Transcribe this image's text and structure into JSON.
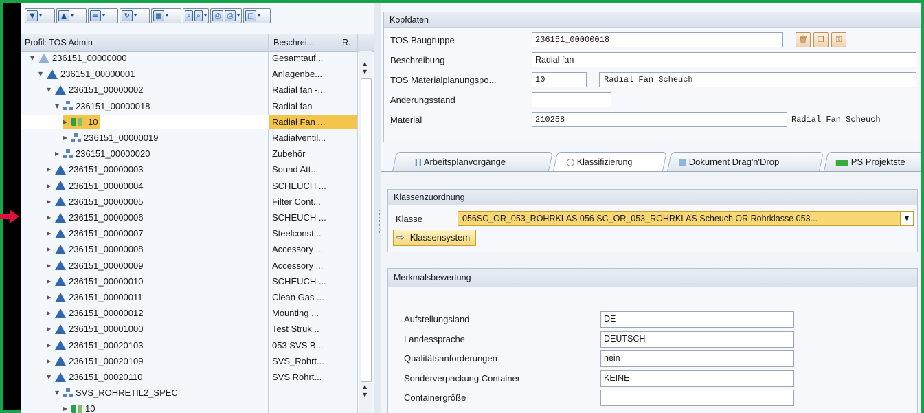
{
  "toolbar": {
    "buttons": [
      {
        "icon": "expand-icon",
        "glyph": "▼"
      },
      {
        "icon": "collapse-icon",
        "glyph": "▲"
      },
      {
        "icon": "list-icon",
        "glyph": "≡"
      },
      {
        "icon": "refresh-icon",
        "glyph": "↻"
      },
      {
        "icon": "layout-icon",
        "glyph": "▦"
      },
      {
        "icon": "find-icon",
        "glyph": "⌕"
      },
      {
        "icon": "print-icon",
        "glyph": "⎙"
      },
      {
        "icon": "window-icon",
        "glyph": "□"
      }
    ]
  },
  "tree_header": {
    "profile": "Profil: TOS Admin",
    "description": "Beschrei...",
    "r": "R."
  },
  "tree": [
    {
      "id": "236151_00000000",
      "desc": "Gesamtauf...",
      "level": 0,
      "expanded": true,
      "icon": "warn-partial"
    },
    {
      "id": "236151_00000001",
      "desc": "Anlagenbe...",
      "level": 1,
      "expanded": true,
      "icon": "warn"
    },
    {
      "id": "236151_00000002",
      "desc": "Radial fan -...",
      "level": 2,
      "expanded": true,
      "icon": "warn"
    },
    {
      "id": "236151_00000018",
      "desc": "Radial fan",
      "level": 3,
      "expanded": true,
      "icon": "org"
    },
    {
      "id": "10",
      "desc": "Radial Fan ...",
      "level": 4,
      "expanded": false,
      "icon": "link",
      "selected": true
    },
    {
      "id": "236151_00000019",
      "desc": "Radialventil...",
      "level": 4,
      "expanded": false,
      "icon": "org"
    },
    {
      "id": "236151_00000020",
      "desc": "Zubehör",
      "level": 3,
      "expanded": false,
      "icon": "org"
    },
    {
      "id": "236151_00000003",
      "desc": "Sound Att...",
      "level": 2,
      "expanded": false,
      "icon": "warn"
    },
    {
      "id": "236151_00000004",
      "desc": "SCHEUCH ...",
      "level": 2,
      "expanded": false,
      "icon": "warn"
    },
    {
      "id": "236151_00000005",
      "desc": "Filter Cont...",
      "level": 2,
      "expanded": false,
      "icon": "warn"
    },
    {
      "id": "236151_00000006",
      "desc": "SCHEUCH ...",
      "level": 2,
      "expanded": false,
      "icon": "warn"
    },
    {
      "id": "236151_00000007",
      "desc": "Steelconst...",
      "level": 2,
      "expanded": false,
      "icon": "warn"
    },
    {
      "id": "236151_00000008",
      "desc": "Accessory ...",
      "level": 2,
      "expanded": false,
      "icon": "warn"
    },
    {
      "id": "236151_00000009",
      "desc": "Accessory ...",
      "level": 2,
      "expanded": false,
      "icon": "warn"
    },
    {
      "id": "236151_00000010",
      "desc": "SCHEUCH ...",
      "level": 2,
      "expanded": false,
      "icon": "warn"
    },
    {
      "id": "236151_00000011",
      "desc": "Clean Gas ...",
      "level": 2,
      "expanded": false,
      "icon": "warn"
    },
    {
      "id": "236151_00000012",
      "desc": "Mounting ...",
      "level": 2,
      "expanded": false,
      "icon": "warn"
    },
    {
      "id": "236151_00001000",
      "desc": "Test Struk...",
      "level": 2,
      "expanded": false,
      "icon": "warn"
    },
    {
      "id": "236151_00020103",
      "desc": "053 SVS B...",
      "level": 2,
      "expanded": false,
      "icon": "warn"
    },
    {
      "id": "236151_00020109",
      "desc": "SVS_Rohrt...",
      "level": 2,
      "expanded": false,
      "icon": "warn"
    },
    {
      "id": "236151_00020110",
      "desc": "SVS Rohrt...",
      "level": 2,
      "expanded": true,
      "icon": "warn"
    },
    {
      "id": "SVS_ROHRETIL2_SPEC",
      "desc": "",
      "level": 3,
      "expanded": true,
      "icon": "org"
    },
    {
      "id": "10",
      "desc": "",
      "level": 4,
      "expanded": false,
      "icon": "link"
    }
  ],
  "kopfdaten": {
    "title": "Kopfdaten",
    "baugruppe_label": "TOS Baugruppe",
    "baugruppe_value": "236151_00000018",
    "beschreibung_label": "Beschreibung",
    "beschreibung_value": "Radial fan",
    "materialplanung_label": "TOS Materialplanungspo...",
    "materialplanung_value": "10",
    "materialplanung_text": "Radial Fan Scheuch",
    "aenderung_label": "Änderungsstand",
    "aenderung_value": "",
    "material_label": "Material",
    "material_value": "210258",
    "material_text": "Radial Fan Scheuch"
  },
  "tabs": [
    {
      "label": "Arbeitsplanvorgänge",
      "icon": "operations-icon"
    },
    {
      "label": "Klassifizierung",
      "icon": "classification-icon",
      "active": true
    },
    {
      "label": "Dokument Drag'n'Drop",
      "icon": "document-icon"
    },
    {
      "label": "PS Projektste",
      "icon": "project-icon"
    }
  ],
  "klassenzuordnung": {
    "title": "Klassenzuordnung",
    "klasse_label": "Klasse",
    "klasse_value": "056SC_OR_053_ROHRKLAS 056 SC_OR_053_ROHRKLAS Scheuch OR Rohrklasse 053...",
    "klassensystem_button": "Klassensystem"
  },
  "merkmalsbewertung": {
    "title": "Merkmalsbewertung",
    "rows": [
      {
        "label": "Aufstellungsland",
        "value": "DE"
      },
      {
        "label": "Landessprache",
        "value": "DEUTSCH"
      },
      {
        "label": "Qualitätsanforderungen",
        "value": "nein"
      },
      {
        "label": "Sonderverpackung Container",
        "value": "KEINE"
      },
      {
        "label": "Containergröße",
        "value": ""
      }
    ]
  },
  "colors": {
    "frame": "#18a34a",
    "selection": "#f4c54a",
    "arrow": "#e0103a",
    "tree_icon": "#2f68b0"
  }
}
